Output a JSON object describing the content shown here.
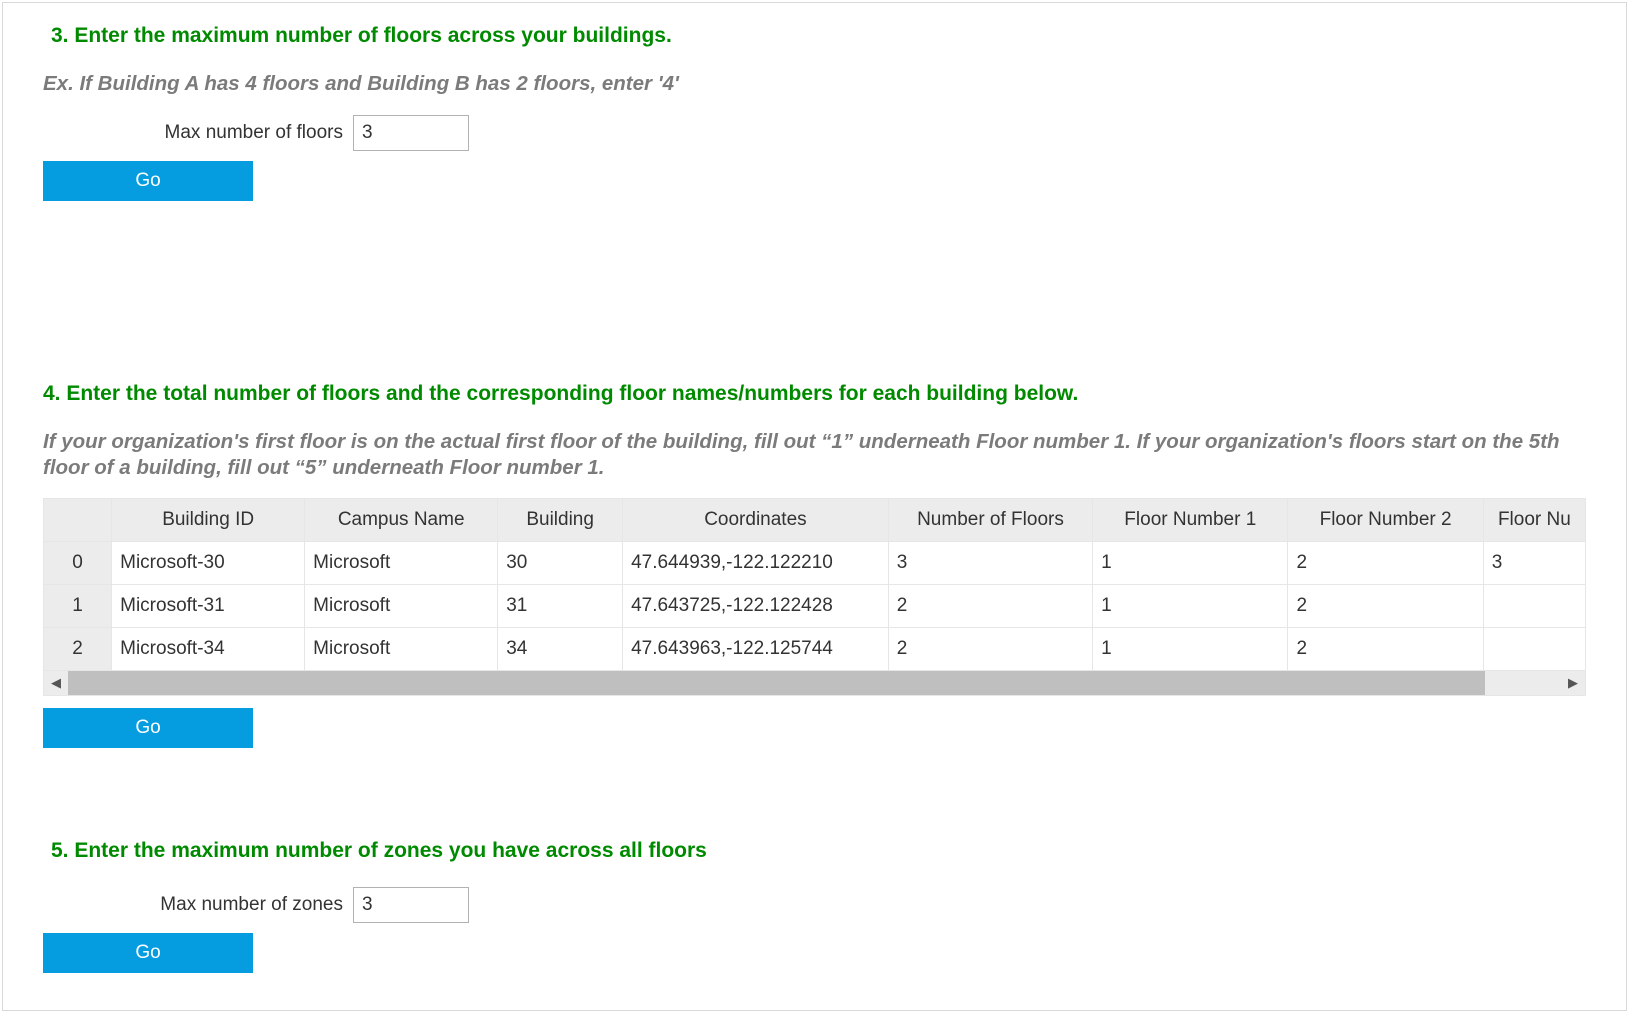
{
  "section3": {
    "heading": "3. Enter the maximum number of floors across your buildings.",
    "example": "Ex. If Building A has 4 floors and Building B has 2 floors, enter '4'",
    "field_label": "Max number of floors",
    "field_value": "3",
    "go_label": "Go"
  },
  "section4": {
    "heading": "4. Enter the total number of floors and the corresponding floor names/numbers for each building below.",
    "example": "If your organization's first floor is on the actual first floor of the building, fill out “1” underneath Floor number 1. If your organization's floors start on the 5th floor of a building, fill out “5” underneath Floor number 1.",
    "go_label": "Go",
    "table": {
      "headers": {
        "index": "",
        "building_id": "Building ID",
        "campus_name": "Campus Name",
        "building": "Building",
        "coordinates": "Coordinates",
        "num_floors": "Number of Floors",
        "floor1": "Floor Number 1",
        "floor2": "Floor Number 2",
        "floor3": "Floor Nu"
      },
      "rows": [
        {
          "index": "0",
          "building_id": "Microsoft-30",
          "campus_name": "Microsoft",
          "building": "30",
          "coordinates": "47.644939,-122.122210",
          "num_floors": "3",
          "floor1": "1",
          "floor2": "2",
          "floor3": "3"
        },
        {
          "index": "1",
          "building_id": "Microsoft-31",
          "campus_name": "Microsoft",
          "building": "31",
          "coordinates": "47.643725,-122.122428",
          "num_floors": "2",
          "floor1": "1",
          "floor2": "2",
          "floor3": ""
        },
        {
          "index": "2",
          "building_id": "Microsoft-34",
          "campus_name": "Microsoft",
          "building": "34",
          "coordinates": "47.643963,-122.125744",
          "num_floors": "2",
          "floor1": "1",
          "floor2": "2",
          "floor3": ""
        }
      ]
    }
  },
  "section5": {
    "heading": "5. Enter the maximum number of zones you have across all floors",
    "field_label": "Max number of zones",
    "field_value": "3",
    "go_label": "Go"
  },
  "colors": {
    "heading_green": "#008a00",
    "example_gray": "#7b7b7b",
    "button_blue": "#069de0"
  }
}
